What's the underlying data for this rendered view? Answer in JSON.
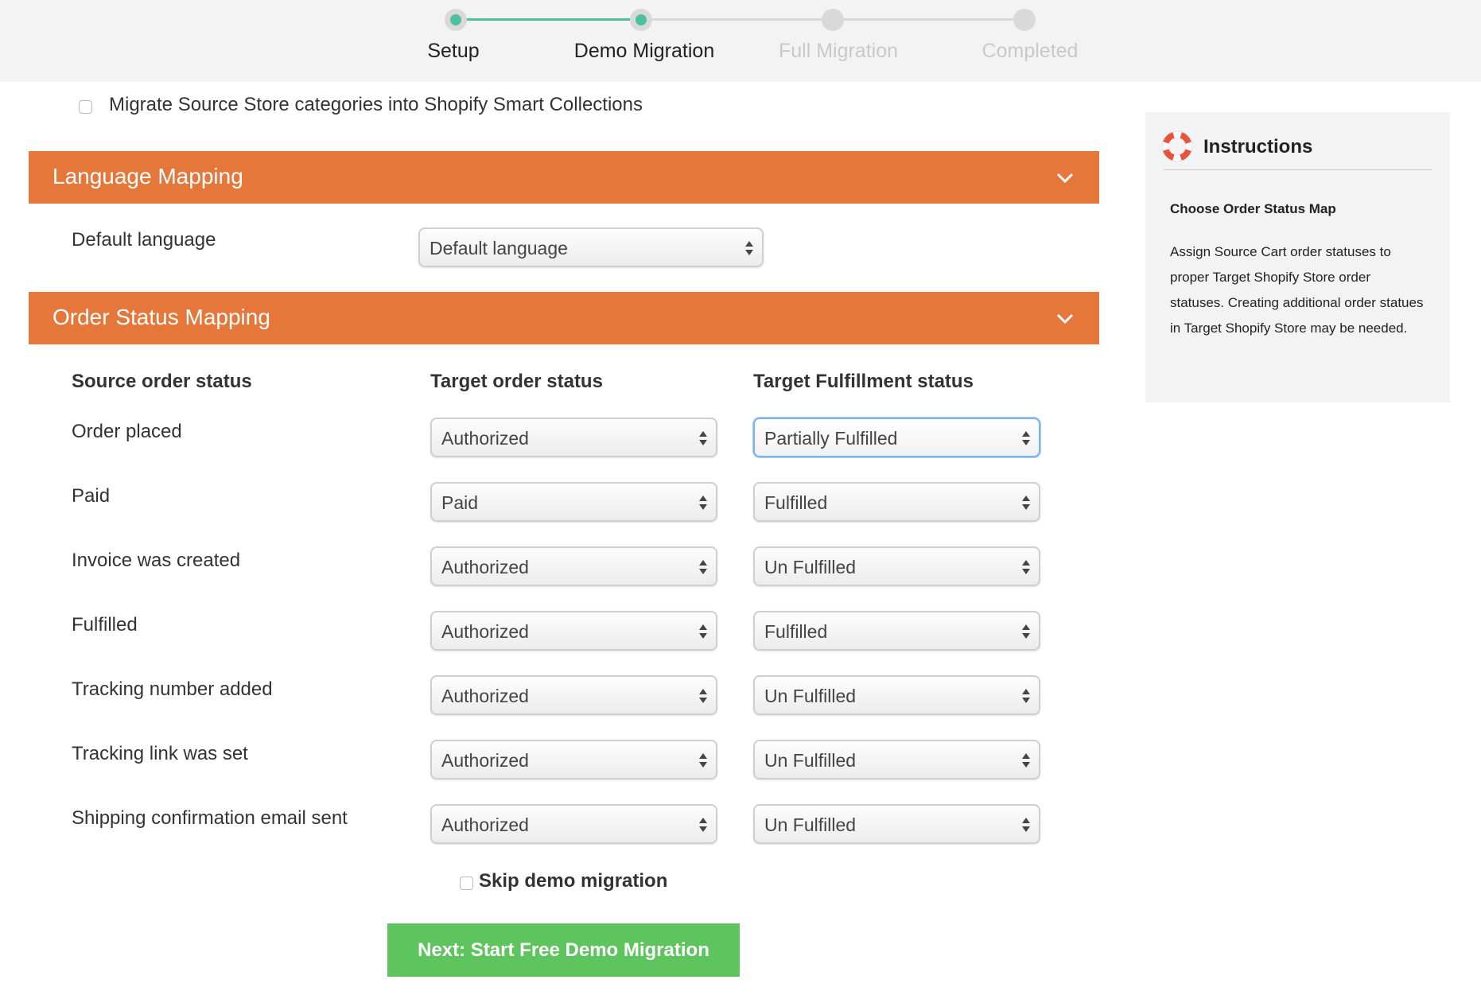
{
  "stepper": {
    "steps": [
      {
        "label": "Setup",
        "state": "done"
      },
      {
        "label": "Demo Migration",
        "state": "current"
      },
      {
        "label": "Full Migration",
        "state": "pending"
      },
      {
        "label": "Completed",
        "state": "pending"
      }
    ],
    "accent_color": "#4cc0a0"
  },
  "options": {
    "smart_collections_label": "Migrate Source Store categories into Shopify Smart Collections",
    "smart_collections_checked": false
  },
  "language_mapping": {
    "title": "Language Mapping",
    "default_language_label": "Default language",
    "default_language_value": "Default language"
  },
  "order_status_mapping": {
    "title": "Order Status Mapping",
    "headers": {
      "source": "Source order status",
      "target": "Target order status",
      "fulfillment": "Target Fulfillment status"
    },
    "rows": [
      {
        "source": "Order placed",
        "target": "Authorized",
        "fulfillment": "Partially Fulfilled"
      },
      {
        "source": "Paid",
        "target": "Paid",
        "fulfillment": "Fulfilled"
      },
      {
        "source": "Invoice was created",
        "target": "Authorized",
        "fulfillment": "Un Fulfilled"
      },
      {
        "source": "Fulfilled",
        "target": "Authorized",
        "fulfillment": "Fulfilled"
      },
      {
        "source": "Tracking number added",
        "target": "Authorized",
        "fulfillment": "Un Fulfilled"
      },
      {
        "source": "Tracking link was set",
        "target": "Authorized",
        "fulfillment": "Un Fulfilled"
      },
      {
        "source": "Shipping confirmation email sent",
        "target": "Authorized",
        "fulfillment": "Un Fulfilled"
      }
    ]
  },
  "footer": {
    "skip_demo_label": "Skip demo migration",
    "skip_demo_checked": false,
    "next_button_label": "Next: Start Free Demo Migration",
    "next_button_color": "#5ec55e"
  },
  "instructions": {
    "title": "Instructions",
    "subtitle": "Choose Order Status Map",
    "body": "Assign Source Cart order statuses to proper Target Shopify Store order statuses. Creating additional order statues in Target Shopify Store may be needed."
  },
  "section_color": "#e5773b"
}
